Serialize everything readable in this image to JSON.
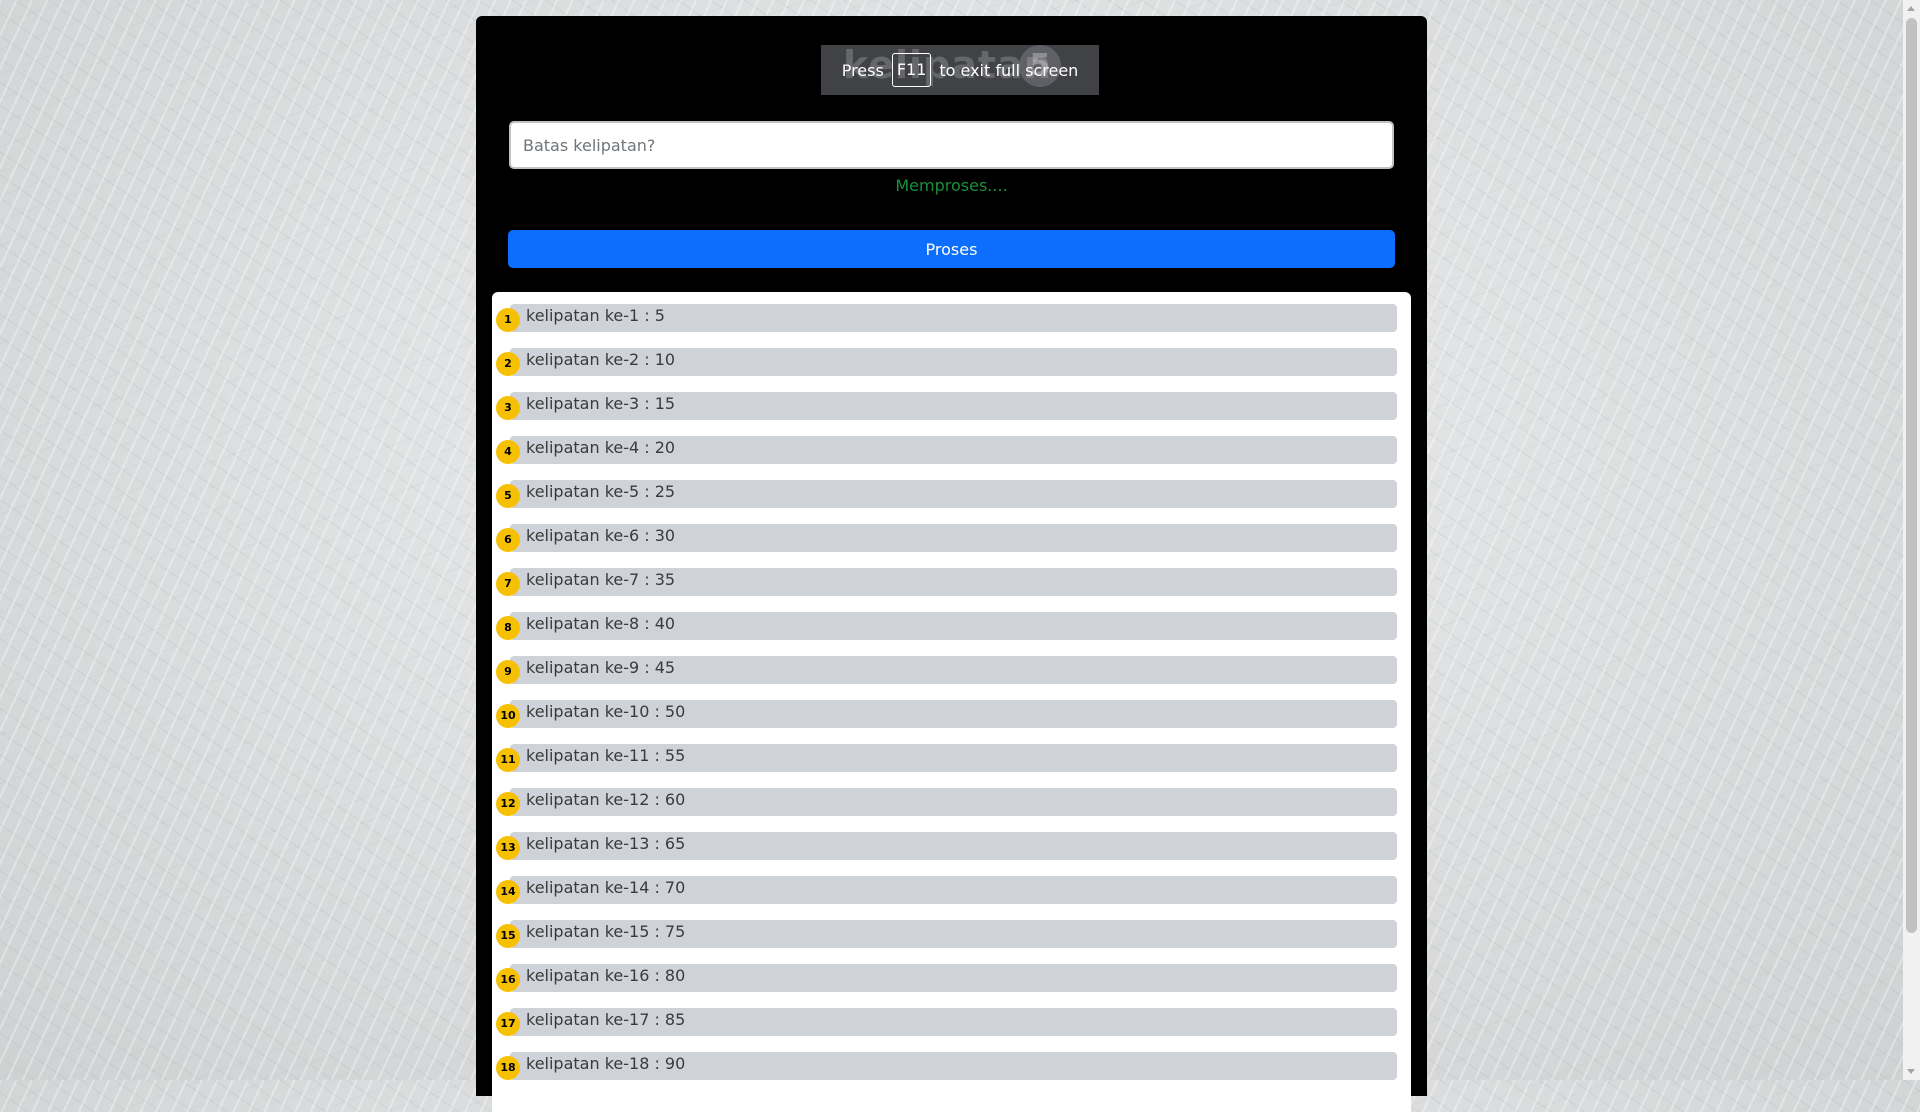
{
  "fullscreen_notice": {
    "press": "Press",
    "key": "F11",
    "rest": "to exit full screen",
    "ghost_title": "kelipatan",
    "ghost_badge": "5"
  },
  "form": {
    "input_placeholder": "Batas kelipatan?",
    "input_value": "",
    "status_text": "Memproses....",
    "submit_label": "Proses"
  },
  "results": [
    {
      "index": "1",
      "label": "kelipatan ke-1 : 5"
    },
    {
      "index": "2",
      "label": "kelipatan ke-2 : 10"
    },
    {
      "index": "3",
      "label": "kelipatan ke-3 : 15"
    },
    {
      "index": "4",
      "label": "kelipatan ke-4 : 20"
    },
    {
      "index": "5",
      "label": "kelipatan ke-5 : 25"
    },
    {
      "index": "6",
      "label": "kelipatan ke-6 : 30"
    },
    {
      "index": "7",
      "label": "kelipatan ke-7 : 35"
    },
    {
      "index": "8",
      "label": "kelipatan ke-8 : 40"
    },
    {
      "index": "9",
      "label": "kelipatan ke-9 : 45"
    },
    {
      "index": "10",
      "label": "kelipatan ke-10 : 50"
    },
    {
      "index": "11",
      "label": "kelipatan ke-11 : 55"
    },
    {
      "index": "12",
      "label": "kelipatan ke-12 : 60"
    },
    {
      "index": "13",
      "label": "kelipatan ke-13 : 65"
    },
    {
      "index": "14",
      "label": "kelipatan ke-14 : 70"
    },
    {
      "index": "15",
      "label": "kelipatan ke-15 : 75"
    },
    {
      "index": "16",
      "label": "kelipatan ke-16 : 80"
    },
    {
      "index": "17",
      "label": "kelipatan ke-17 : 85"
    },
    {
      "index": "18",
      "label": "kelipatan ke-18 : 90"
    }
  ],
  "colors": {
    "badge": "#f6c103",
    "button": "#0d6efd",
    "status": "#198f3a",
    "row_bar": "#cfd3d9"
  }
}
